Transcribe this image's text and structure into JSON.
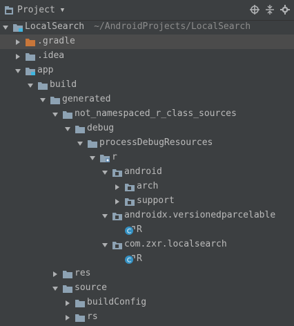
{
  "header": {
    "title": "Project",
    "tools": [
      "target-icon",
      "collapse-icon",
      "settings-icon"
    ]
  },
  "tree": [
    {
      "label": "LocalSearch",
      "path": "~/AndroidProjects/LocalSearch",
      "level": 0,
      "expanded": true,
      "icon": "module-folder-icon"
    },
    {
      "label": ".gradle",
      "level": 1,
      "expanded": false,
      "icon": "orange-folder-icon",
      "selected": true
    },
    {
      "label": ".idea",
      "level": 1,
      "expanded": false,
      "icon": "folder-icon"
    },
    {
      "label": "app",
      "level": 1,
      "expanded": true,
      "icon": "module-folder-icon"
    },
    {
      "label": "build",
      "level": 2,
      "expanded": true,
      "icon": "folder-icon"
    },
    {
      "label": "generated",
      "level": 3,
      "expanded": true,
      "icon": "folder-icon"
    },
    {
      "label": "not_namespaced_r_class_sources",
      "level": 4,
      "expanded": true,
      "icon": "folder-icon"
    },
    {
      "label": "debug",
      "level": 5,
      "expanded": true,
      "icon": "folder-icon"
    },
    {
      "label": "processDebugResources",
      "level": 6,
      "expanded": true,
      "icon": "folder-icon"
    },
    {
      "label": "r",
      "level": 7,
      "expanded": true,
      "icon": "source-root-folder-icon"
    },
    {
      "label": "android",
      "level": 8,
      "expanded": true,
      "icon": "package-icon"
    },
    {
      "label": "arch",
      "level": 9,
      "expanded": false,
      "icon": "package-icon"
    },
    {
      "label": "support",
      "level": 9,
      "expanded": false,
      "icon": "package-icon"
    },
    {
      "label": "androidx.versionedparcelable",
      "level": 8,
      "expanded": true,
      "icon": "package-icon"
    },
    {
      "label": "R",
      "level": 9,
      "leaf": true,
      "icon": "class-icon"
    },
    {
      "label": "com.zxr.localsearch",
      "level": 8,
      "expanded": true,
      "icon": "package-icon"
    },
    {
      "label": "R",
      "level": 9,
      "leaf": true,
      "icon": "class-icon"
    },
    {
      "label": "res",
      "level": 4,
      "expanded": false,
      "icon": "folder-icon"
    },
    {
      "label": "source",
      "level": 4,
      "expanded": true,
      "icon": "folder-icon"
    },
    {
      "label": "buildConfig",
      "level": 5,
      "expanded": false,
      "icon": "folder-icon"
    },
    {
      "label": "rs",
      "level": 5,
      "expanded": false,
      "icon": "folder-icon"
    }
  ]
}
